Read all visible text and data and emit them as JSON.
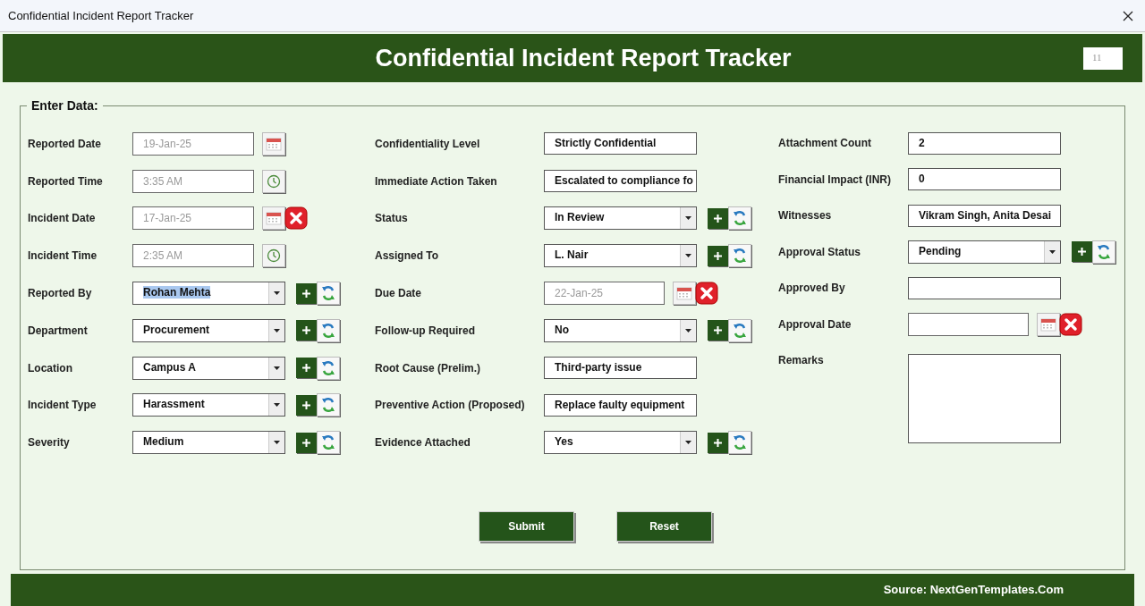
{
  "window": {
    "title": "Confidential Incident Report Tracker"
  },
  "header": {
    "title": "Confidential Incident Report Tracker",
    "record_number": "11"
  },
  "section": {
    "legend": "Enter Data:"
  },
  "columns": [
    {
      "fields": [
        {
          "kind": "date",
          "label": "Reported Date",
          "value": "19-Jan-25",
          "clearable": false,
          "disabled": true
        },
        {
          "kind": "time",
          "label": "Reported Time",
          "value": "3:35 AM",
          "disabled": true
        },
        {
          "kind": "date",
          "label": "Incident Date",
          "value": "17-Jan-25",
          "clearable": true,
          "disabled": true
        },
        {
          "kind": "time",
          "label": "Incident Time",
          "value": "2:35 AM",
          "disabled": true
        },
        {
          "kind": "dropdown",
          "label": "Reported By",
          "value": "Rohan Mehta",
          "highlighted": true
        },
        {
          "kind": "dropdown",
          "label": "Department",
          "value": "Procurement",
          "highlighted": false
        },
        {
          "kind": "dropdown",
          "label": "Location",
          "value": "Campus A",
          "highlighted": false
        },
        {
          "kind": "dropdown",
          "label": "Incident Type",
          "value": "Harassment",
          "highlighted": false
        },
        {
          "kind": "dropdown",
          "label": "Severity",
          "value": "Medium",
          "highlighted": false
        }
      ]
    },
    {
      "fields": [
        {
          "kind": "text",
          "label": "Confidentiality Level",
          "value": "Strictly Confidential"
        },
        {
          "kind": "text",
          "label": "Immediate Action Taken",
          "value": "Escalated to compliance fo"
        },
        {
          "kind": "dropdown",
          "label": "Status",
          "value": "In Review",
          "highlighted": false
        },
        {
          "kind": "dropdown",
          "label": "Assigned To",
          "value": "L. Nair",
          "highlighted": false
        },
        {
          "kind": "date",
          "label": "Due Date",
          "value": "22-Jan-25",
          "clearable": true,
          "disabled": true
        },
        {
          "kind": "dropdown",
          "label": "Follow-up Required",
          "value": "No",
          "highlighted": false
        },
        {
          "kind": "text",
          "label": "Root Cause (Prelim.)",
          "value": "Third-party issue"
        },
        {
          "kind": "text",
          "label": "Preventive Action (Proposed)",
          "value": "Replace faulty equipment"
        },
        {
          "kind": "dropdown",
          "label": "Evidence Attached",
          "value": "Yes",
          "highlighted": false
        }
      ]
    },
    {
      "fields": [
        {
          "kind": "text",
          "label": "Attachment Count",
          "value": "2"
        },
        {
          "kind": "text",
          "label": "Financial Impact (INR)",
          "value": "0"
        },
        {
          "kind": "text",
          "label": "Witnesses",
          "value": "Vikram Singh, Anita Desai"
        },
        {
          "kind": "dropdown",
          "label": "Approval Status",
          "value": "Pending",
          "highlighted": false
        },
        {
          "kind": "text",
          "label": "Approved By"
        },
        {
          "kind": "date",
          "label": "Approval Date",
          "clearable": true
        },
        {
          "kind": "textarea",
          "label": "Remarks"
        }
      ]
    }
  ],
  "buttons": [
    {
      "label": "Submit"
    },
    {
      "label": "Reset"
    }
  ],
  "footer": {
    "text": "Source: NextGenTemplates.Com"
  }
}
